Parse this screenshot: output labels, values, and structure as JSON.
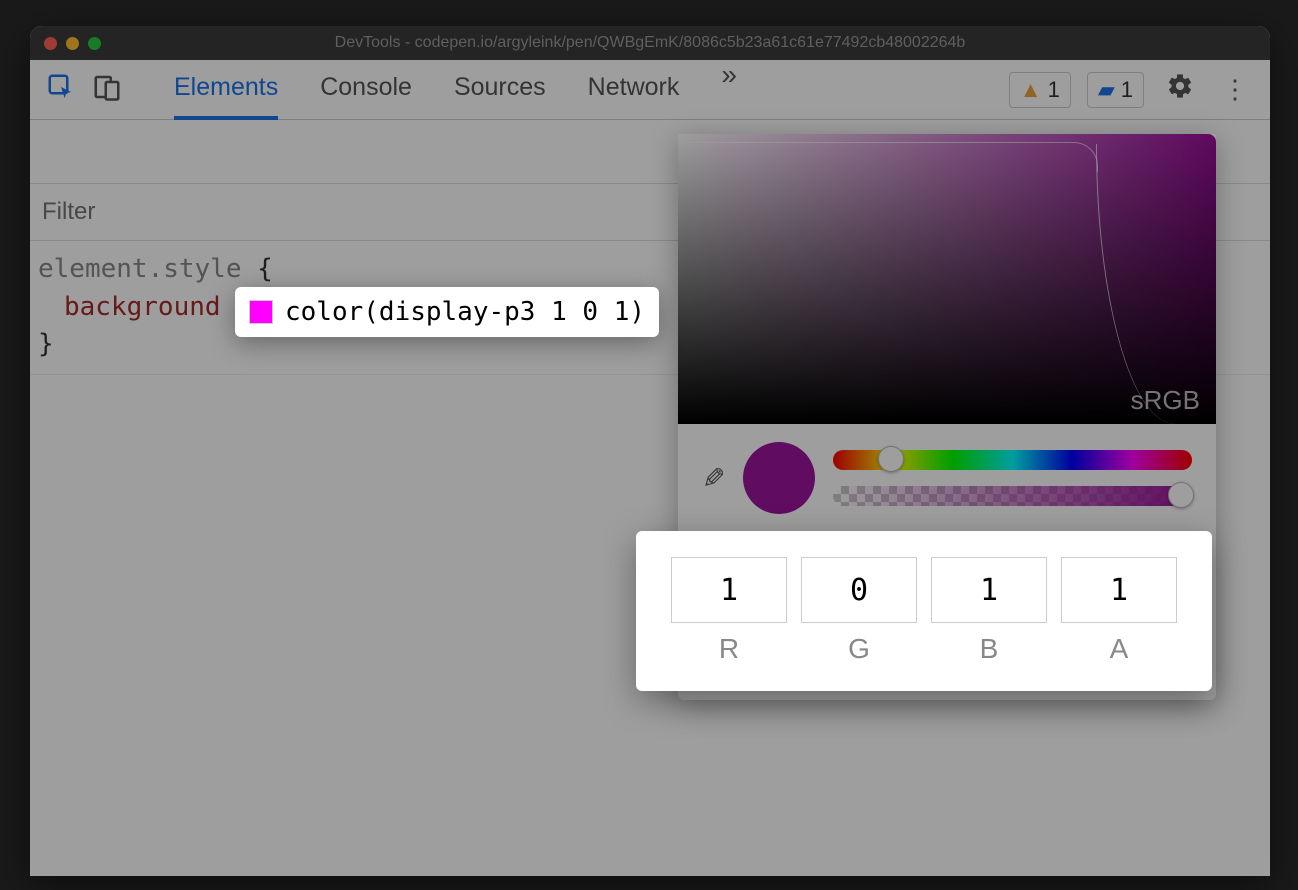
{
  "window": {
    "title": "DevTools - codepen.io/argyleink/pen/QWBgEmK/8086c5b23a61c61e77492cb48002264b"
  },
  "toolbar": {
    "tabs": [
      "Elements",
      "Console",
      "Sources",
      "Network"
    ],
    "active_tab_index": 0,
    "overflow_glyph": "»",
    "warnings_count": "1",
    "messages_count": "1"
  },
  "styles": {
    "filter_placeholder": "Filter",
    "selector": "element.style",
    "brace_open": "{",
    "brace_close": "}",
    "property": "background",
    "value": "color(display-p3 1 0 1)"
  },
  "picker": {
    "gamut_label": "sRGB",
    "hue_thumb_left_pct": 16,
    "alpha_thumb_left_pct": 97,
    "channels": [
      {
        "label": "R",
        "value": "1"
      },
      {
        "label": "G",
        "value": "0"
      },
      {
        "label": "B",
        "value": "1"
      },
      {
        "label": "A",
        "value": "1"
      }
    ],
    "palette": [
      [
        "#8a8ae6",
        "#000000",
        "#222222",
        "#e6c800",
        "#d4b400",
        "#ffffff",
        "#ffffff",
        "#999999"
      ],
      [
        "#888888",
        "#555555",
        "#444444",
        "#2a2a2a",
        "checker",
        "checker",
        "#000000",
        "checker"
      ],
      [
        "#333333",
        "checker",
        "checker",
        "#222222",
        "#1a1a1a",
        "#1a1a1a",
        "checker",
        "#111111"
      ]
    ]
  },
  "colors": {
    "swatch_mini": "#ff00ff",
    "big_swatch": "#9b149b"
  }
}
